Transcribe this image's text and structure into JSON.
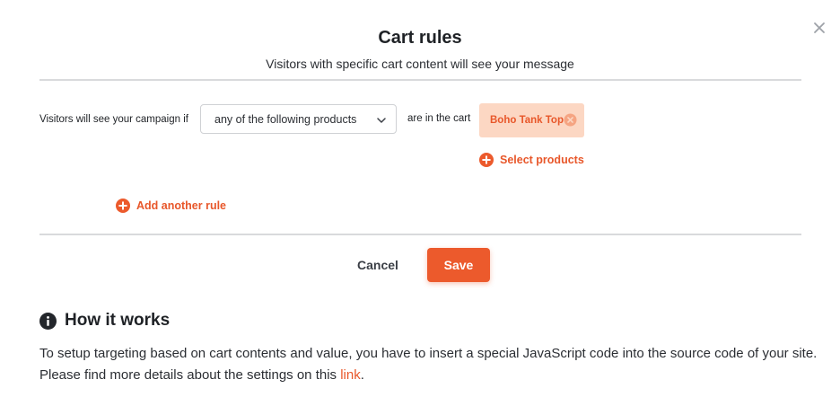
{
  "dialog": {
    "title": "Cart rules",
    "subtitle": "Visitors with specific cart content will see your message"
  },
  "rule": {
    "prefix_label": "Visitors will see your campaign if",
    "condition_select": {
      "value": "any of the following products"
    },
    "suffix_label": "are in the cart",
    "products": [
      {
        "label": "Boho Tank Top"
      }
    ],
    "select_products_label": "Select products"
  },
  "add_rule_label": "Add another rule",
  "actions": {
    "cancel_label": "Cancel",
    "save_label": "Save"
  },
  "how_it_works": {
    "title": "How it works",
    "text_before_link": "To setup targeting based on cart contents and value, you have to insert a special JavaScript code into the source code of your site. Please find more details about the settings on this ",
    "link_text": "link",
    "text_after_link": "."
  },
  "colors": {
    "accent": "#ec5a2c",
    "accent_text": "#e8572a",
    "chip_background": "#fcd7c3",
    "divider": "#d9dadc"
  },
  "icons": [
    "close-icon",
    "chevron-down-icon",
    "remove-circle-icon",
    "plus-circle-icon",
    "info-circle-icon"
  ]
}
